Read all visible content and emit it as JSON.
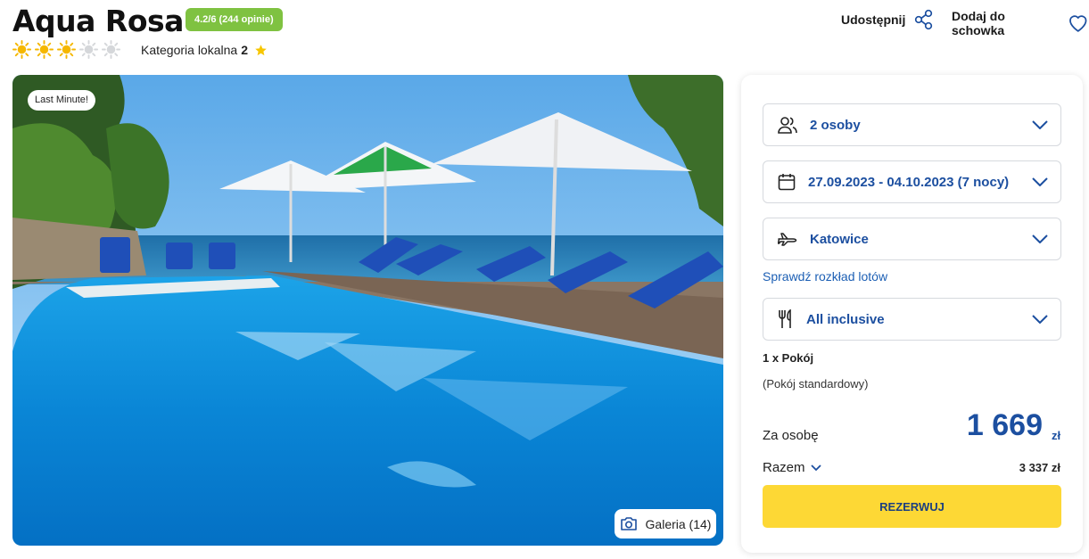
{
  "hotel": {
    "name": "Aqua Rosa",
    "rating_badge": "4.2/6 (244 opinie)",
    "sun_rating": 3,
    "sun_max": 5,
    "local_category_label": "Kategoria lokalna",
    "local_category_value": "2"
  },
  "actions": {
    "share_label": "Udostępnij",
    "favorite_label": "Dodaj do schowka"
  },
  "photo": {
    "badge": "Last Minute!",
    "gallery_label": "Galeria (14)"
  },
  "booking": {
    "guests": "2 osoby",
    "dates": "27.09.2023 - 04.10.2023 (7 nocy)",
    "departure": "Katowice",
    "schedule_link": "Sprawdź rozkład lotów",
    "board": "All inclusive",
    "room_count": "1 x Pokój",
    "room_type": "(Pokój standardowy)",
    "per_person_label": "Za osobę",
    "price": "1 669",
    "currency": "zł",
    "total_label": "Razem",
    "total_value": "3 337 zł",
    "book_button": "REZERWUJ"
  },
  "colors": {
    "brand_blue": "#1c4fa0",
    "rating_green": "#7fc241",
    "button_yellow": "#fdd835",
    "sun_active": "#f5b700",
    "sun_inactive": "#d5d7da"
  }
}
